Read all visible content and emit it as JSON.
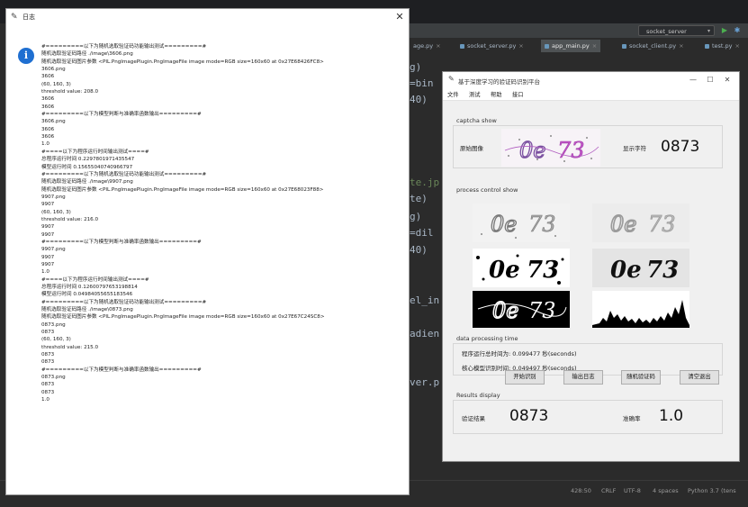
{
  "ide": {
    "run_config": "socket_server",
    "tabs": [
      {
        "label": "age.py"
      },
      {
        "label": "socket_server.py"
      },
      {
        "label": "app_main.py"
      },
      {
        "label": "socket_client.py"
      },
      {
        "label": "test.py"
      }
    ],
    "code_fragments": [
      "g)",
      "=bin",
      "40)",
      "te.jp",
      "te)",
      "g)",
      "=dil",
      "40)",
      "el_in",
      "adien",
      "ver.p"
    ],
    "status": {
      "position": "428:50",
      "line_ending": "CRLF",
      "encoding": "UTF-8",
      "indent": "4 spaces",
      "interpreter": "Python 3.7 (tens"
    }
  },
  "log_dialog": {
    "title": "日志",
    "lines": [
      "#=========以下为随机选取验证码功能输出测试=========#",
      "随机选取验证码路径 ./image\\3606.png",
      "随机选取验证码图片参数 <PIL.PngImagePlugin.PngImageFile image mode=RGB size=160x60 at 0x27E68426FC8>",
      "3606.png",
      "3606",
      "(60, 160, 3)",
      "threshold value: 208.0",
      "3606",
      "3606",
      "#=========以下为模型判断与准确率函数输出=========#",
      "3606.png",
      "3606",
      "3606",
      "1.0",
      "#====以下为程序运行时间输出测试====#",
      "总程序运行时间 0.2297801971435547",
      "模型运行时间 0.15655040740966797",
      "#=========以下为随机选取验证码功能输出测试=========#",
      "随机选取验证码路径 ./image\\9907.png",
      "随机选取验证码图片参数 <PIL.PngImagePlugin.PngImageFile image mode=RGB size=160x60 at 0x27E68023F88>",
      "9907.png",
      "9907",
      "(60, 160, 3)",
      "threshold value: 216.0",
      "9907",
      "9907",
      "#=========以下为模型判断与准确率函数输出=========#",
      "9907.png",
      "9907",
      "9907",
      "1.0",
      "#====以下为程序运行时间输出测试====#",
      "总程序运行时间 0.12600797653198814",
      "模型运行时间 0.04984055655183546",
      "#=========以下为随机选取验证码功能输出测试=========#",
      "随机选取验证码路径 ./image\\0873.png",
      "随机选取验证码图片参数 <PIL.PngImagePlugin.PngImageFile image mode=RGB size=160x60 at 0x27E67C24SC8>",
      "0873.png",
      "0873",
      "(60, 160, 3)",
      "threshold value: 215.0",
      "0873",
      "0873",
      "#=========以下为模型判断与准确率函数输出=========#",
      "0873.png",
      "0873",
      "0873",
      "1.0"
    ]
  },
  "app": {
    "title": "基于深度学习的验证码识别平台",
    "menu": [
      "文件",
      "测试",
      "帮助",
      "接口"
    ],
    "captcha_show": {
      "section": "captcha show",
      "original_label": "原始图像",
      "display_label": "显示字符",
      "display_value": "0873"
    },
    "process_control": {
      "section": "process control show"
    },
    "data_processing": {
      "section": "data processing time",
      "total_time": "程序运行总时间为: 0.099477 秒(seconds)",
      "model_time": "核心模型识别时间: 0.049497 秒(seconds)"
    },
    "results": {
      "section": "Results display",
      "result_label": "验证结果",
      "result_value": "0873",
      "accuracy_label": "准确率",
      "accuracy_value": "1.0"
    },
    "buttons": [
      "开始识别",
      "输出日志",
      "随机验证码",
      "清空退出"
    ]
  }
}
